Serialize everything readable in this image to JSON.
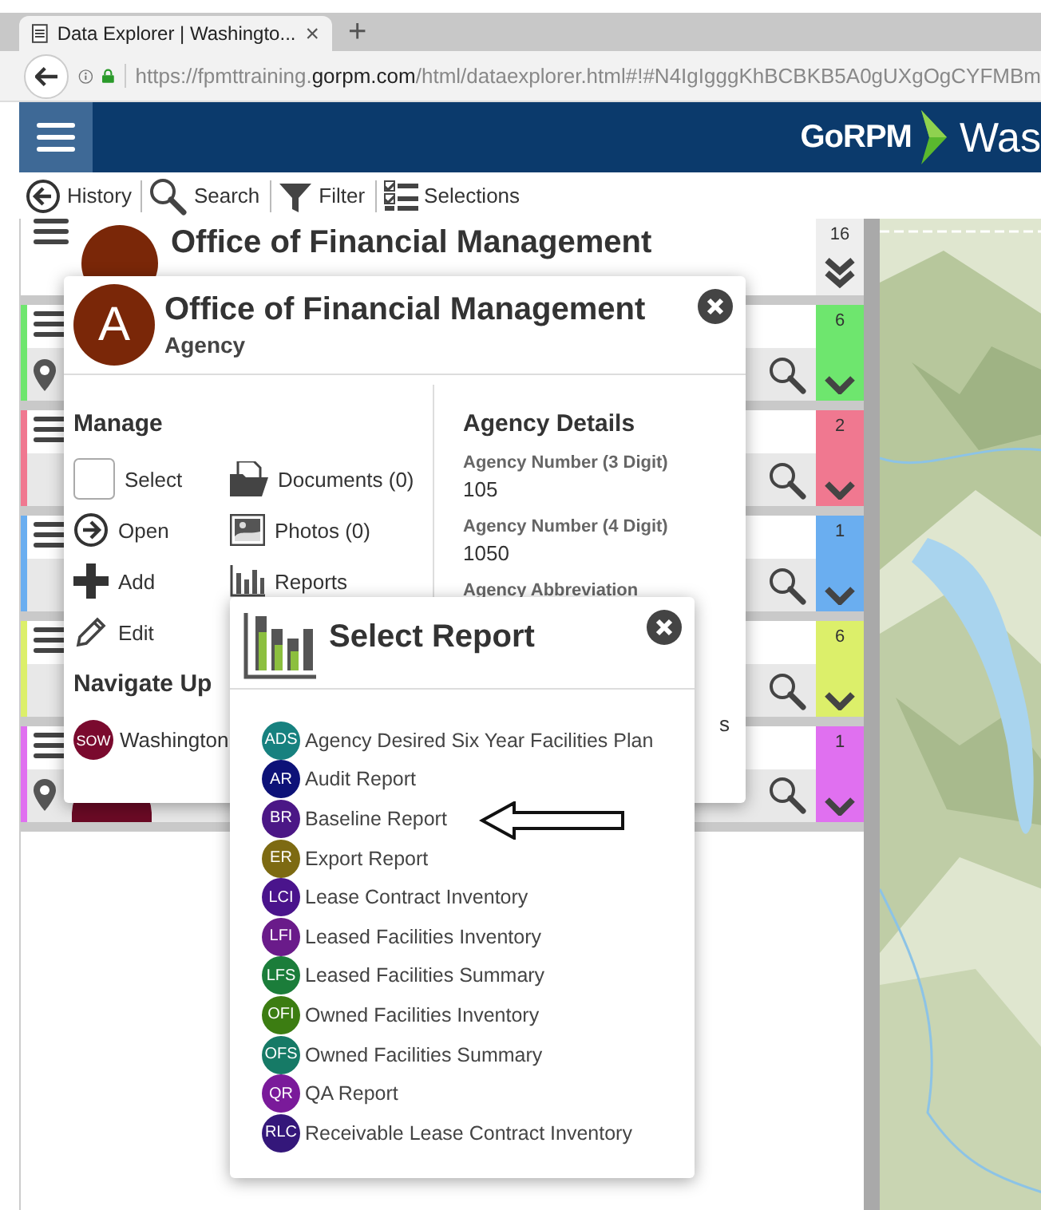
{
  "browser": {
    "tab_title": "Data Explorer | Washingto...",
    "tab_close": "×",
    "new_tab": "+",
    "url": "https://fpmttraining.**gorpm.com**/html/dataexplorer.html#!#N4IgIgggKhBCBKB5A0gUXgOgCYFMBm"
  },
  "header": {
    "logo": "GoRPM",
    "title": "Was"
  },
  "toolbar": [
    {
      "label": "History",
      "kind": "history"
    },
    {
      "label": "Search",
      "kind": "search"
    },
    {
      "label": "Filter",
      "kind": "filter"
    },
    {
      "label": "Selections",
      "kind": "selections"
    }
  ],
  "top_card": {
    "title": "Office of Financial Management",
    "count": "16"
  },
  "cards": [
    {
      "color": "#6ee66e",
      "count": "6",
      "pin": true,
      "avatar": false
    },
    {
      "color": "#f07890",
      "count": "2",
      "pin": false,
      "avatar": false
    },
    {
      "color": "#6aaef0",
      "count": "1",
      "pin": false,
      "avatar": false
    },
    {
      "color": "#dcef6a",
      "count": "6",
      "pin": false,
      "avatar": false
    },
    {
      "color": "#e070f0",
      "count": "1",
      "pin": true,
      "avatar": true
    }
  ],
  "agency_popup": {
    "avatar": "A",
    "title": "Office of Financial Management",
    "subtitle": "Agency",
    "manage_heading": "Manage",
    "manage": [
      {
        "label": "Select",
        "kind": "select",
        "checked": false
      },
      {
        "label": "Documents (0)",
        "kind": "documents"
      },
      {
        "label": "Open",
        "kind": "open"
      },
      {
        "label": "Photos (0)",
        "kind": "photos"
      },
      {
        "label": "Add",
        "kind": "add"
      },
      {
        "label": "Reports",
        "kind": "reports"
      },
      {
        "label": "Edit",
        "kind": "edit"
      }
    ],
    "navigate_heading": "Navigate Up",
    "navigate": [
      {
        "badge": "SOW",
        "label": "Washington"
      }
    ],
    "details_heading": "Agency Details",
    "details": [
      {
        "label": "Agency Number (3 Digit)",
        "value": "105"
      },
      {
        "label": "Agency Number (4 Digit)",
        "value": "1050"
      },
      {
        "label": "Agency Abbreviation"
      }
    ],
    "details_tail": "s"
  },
  "report_popup": {
    "title": "Select Report",
    "items": [
      {
        "badge": "ADS",
        "label": "Agency Desired Six Year Facilities Plan",
        "color": "#17817f",
        "pointed": false
      },
      {
        "badge": "AR",
        "label": "Audit Report",
        "color": "#0d1278",
        "pointed": false
      },
      {
        "badge": "BR",
        "label": "Baseline Report",
        "color": "#4b1786",
        "pointed": true
      },
      {
        "badge": "ER",
        "label": "Export Report",
        "color": "#7d6a12",
        "pointed": false
      },
      {
        "badge": "LCI",
        "label": "Lease Contract Inventory",
        "color": "#4a148c",
        "pointed": false
      },
      {
        "badge": "LFI",
        "label": "Leased Facilities Inventory",
        "color": "#6a1b8a",
        "pointed": false
      },
      {
        "badge": "LFS",
        "label": "Leased Facilities Summary",
        "color": "#1b7d3a",
        "pointed": false
      },
      {
        "badge": "OFI",
        "label": "Owned Facilities Inventory",
        "color": "#3c7d12",
        "pointed": false
      },
      {
        "badge": "OFS",
        "label": "Owned Facilities Summary",
        "color": "#167a66",
        "pointed": false
      },
      {
        "badge": "QR",
        "label": "QA Report",
        "color": "#7a1a9a",
        "pointed": false
      },
      {
        "badge": "RLC",
        "label": "Receivable Lease Contract Inventory",
        "color": "#34177a",
        "pointed": false
      }
    ]
  }
}
